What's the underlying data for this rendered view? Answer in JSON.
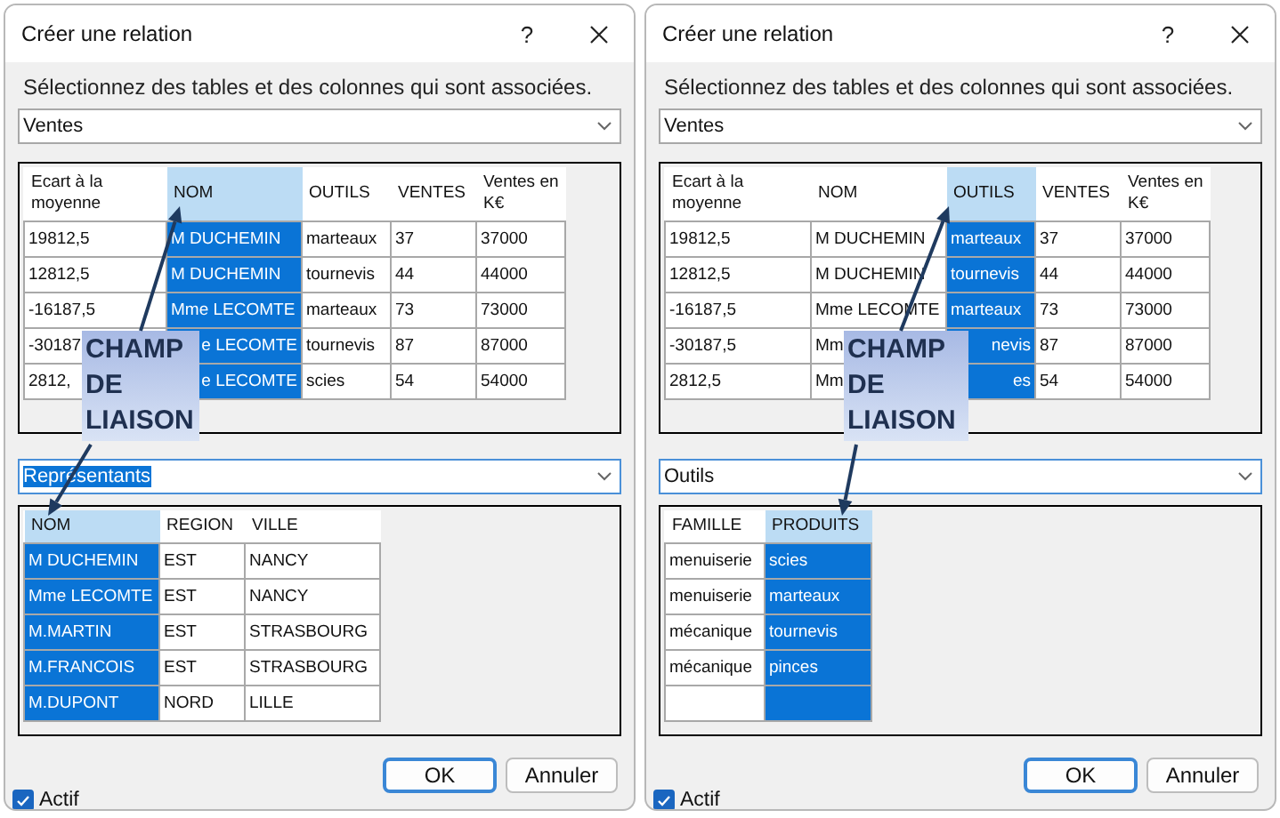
{
  "dialogs": [
    {
      "title": "Créer une relation",
      "help": "?",
      "instruction": "Sélectionnez des tables et des colonnes qui sont associées.",
      "upper": {
        "combo": {
          "value": "Ventes",
          "text_selected": false,
          "focused": false
        },
        "columns": [
          {
            "label": "Ecart à la moyenne",
            "selected": false
          },
          {
            "label": "NOM",
            "selected": true
          },
          {
            "label": "OUTILS",
            "selected": false
          },
          {
            "label": "VENTES",
            "selected": false
          },
          {
            "label": "Ventes en K€",
            "selected": false
          }
        ],
        "rows": [
          {
            "cells": [
              "19812,5",
              "M DUCHEMIN",
              "marteaux",
              "37",
              "37000"
            ]
          },
          {
            "cells": [
              "12812,5",
              "M DUCHEMIN",
              "tournevis",
              "44",
              "44000"
            ]
          },
          {
            "cells": [
              "-16187,5",
              "Mme LECOMTE",
              "marteaux",
              "73",
              "73000"
            ]
          },
          {
            "cells": [
              "-30187",
              {
                "text": "e LECOMTE",
                "cut_start": true
              },
              "tournevis",
              "87",
              "87000"
            ]
          },
          {
            "cells": [
              "2812,",
              {
                "text": "e LECOMTE",
                "cut_start": true
              },
              "scies",
              "54",
              "54000"
            ]
          }
        ]
      },
      "callout": {
        "lines": [
          "CHAMP",
          "DE",
          "LIAISON"
        ]
      },
      "lower": {
        "combo": {
          "value": "Représentants",
          "text_selected": true,
          "focused": true
        },
        "columns": [
          {
            "label": "NOM",
            "selected": true
          },
          {
            "label": "REGION",
            "selected": false
          },
          {
            "label": "VILLE",
            "selected": false
          }
        ],
        "rows": [
          {
            "cells": [
              "M DUCHEMIN",
              "EST",
              "NANCY"
            ]
          },
          {
            "cells": [
              "Mme LECOMTE",
              "EST",
              "NANCY"
            ]
          },
          {
            "cells": [
              "M.MARTIN",
              "EST",
              "STRASBOURG"
            ]
          },
          {
            "cells": [
              "M.FRANCOIS",
              "EST",
              "STRASBOURG"
            ]
          },
          {
            "cells": [
              "M.DUPONT",
              "NORD",
              "LILLE"
            ]
          }
        ]
      },
      "active": {
        "label": "Actif",
        "checked": true
      },
      "buttons": [
        {
          "label": "OK",
          "default": true
        },
        {
          "label": "Annuler",
          "default": false
        }
      ]
    },
    {
      "title": "Créer une relation",
      "help": "?",
      "instruction": "Sélectionnez des tables et des colonnes qui sont associées.",
      "upper": {
        "combo": {
          "value": "Ventes",
          "text_selected": false,
          "focused": false
        },
        "columns": [
          {
            "label": "Ecart à la moyenne",
            "selected": false
          },
          {
            "label": "NOM",
            "selected": false
          },
          {
            "label": "OUTILS",
            "selected": true
          },
          {
            "label": "VENTES",
            "selected": false
          },
          {
            "label": "Ventes en K€",
            "selected": false
          }
        ],
        "rows": [
          {
            "cells": [
              "19812,5",
              "M DUCHEMIN",
              "marteaux",
              "37",
              "37000"
            ]
          },
          {
            "cells": [
              "12812,5",
              "M DUCHEMIN",
              "tournevis",
              "44",
              "44000"
            ]
          },
          {
            "cells": [
              "-16187,5",
              "Mme LECOMTE",
              "marteaux",
              "73",
              "73000"
            ]
          },
          {
            "cells": [
              "-30187,5",
              "Mm",
              {
                "text": "nevis",
                "cut_start": true
              },
              "87",
              "87000"
            ]
          },
          {
            "cells": [
              "2812,5",
              "Mm",
              {
                "text": "es",
                "cut_start": true
              },
              "54",
              "54000"
            ]
          }
        ]
      },
      "callout": {
        "lines": [
          "CHAMP",
          "DE",
          "LIAISON"
        ]
      },
      "lower": {
        "combo": {
          "value": "Outils",
          "text_selected": false,
          "focused": true
        },
        "columns": [
          {
            "label": "FAMILLE",
            "selected": false
          },
          {
            "label": "PRODUITS",
            "selected": true
          }
        ],
        "rows": [
          {
            "cells": [
              "menuiserie",
              "scies"
            ]
          },
          {
            "cells": [
              "menuiserie",
              "marteaux"
            ]
          },
          {
            "cells": [
              "mécanique",
              "tournevis"
            ]
          },
          {
            "cells": [
              "mécanique",
              "pinces"
            ]
          },
          {
            "kind": "new"
          }
        ]
      },
      "active": {
        "label": "Actif",
        "checked": true
      },
      "buttons": [
        {
          "label": "OK",
          "default": true
        },
        {
          "label": "Annuler",
          "default": false
        }
      ]
    }
  ]
}
